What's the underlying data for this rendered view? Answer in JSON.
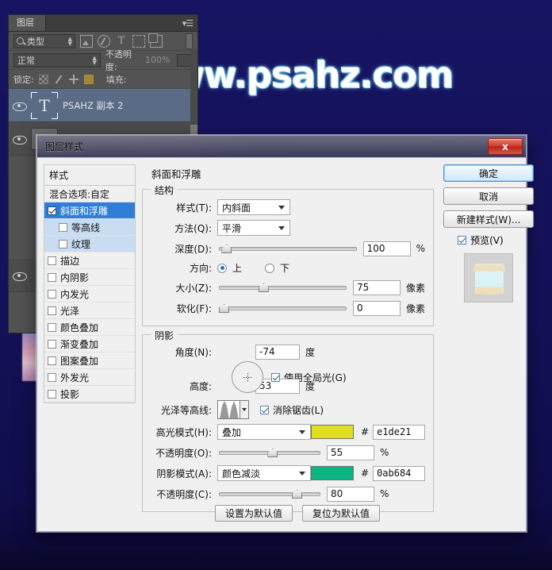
{
  "canvas": {
    "watermark": "www.psahz.com",
    "bg_color": "#14125a"
  },
  "layers_panel": {
    "tab_label": "图层",
    "menu_icon": "panel-menu-icon",
    "filter": {
      "search_icon": "search-icon",
      "type_label": "类型",
      "icons": [
        "image-filter-icon",
        "adjustment-filter-icon",
        "text-filter-icon",
        "shape-filter-icon",
        "smartobject-filter-icon"
      ]
    },
    "blend_mode": "正常",
    "opacity_label": "不透明度:",
    "opacity_value": "100%",
    "lock_label": "锁定:",
    "fill_label": "填充:",
    "lock_icons": [
      "lock-transparent-icon",
      "lock-brush-icon",
      "lock-move-icon",
      "lock-all-icon"
    ],
    "layers": [
      {
        "name": "PSAHZ 副本 2",
        "type": "text",
        "visible": true,
        "selected": true
      },
      {
        "name": "",
        "type": "raster",
        "visible": true,
        "selected": false
      },
      {
        "name": "",
        "type": "raster",
        "visible": true,
        "selected": false
      }
    ]
  },
  "dialog": {
    "title": "图层样式",
    "close_label": "x",
    "styles": {
      "header": "样式",
      "items": [
        {
          "label": "混合选项:自定",
          "checkbox": false,
          "has_checkbox": false,
          "state": "plain"
        },
        {
          "label": "斜面和浮雕",
          "checkbox": true,
          "has_checkbox": true,
          "state": "active"
        },
        {
          "label": "等高线",
          "checkbox": false,
          "has_checkbox": true,
          "state": "sub"
        },
        {
          "label": "纹理",
          "checkbox": false,
          "has_checkbox": true,
          "state": "sub"
        },
        {
          "label": "描边",
          "checkbox": false,
          "has_checkbox": true,
          "state": "plain"
        },
        {
          "label": "内阴影",
          "checkbox": false,
          "has_checkbox": true,
          "state": "plain"
        },
        {
          "label": "内发光",
          "checkbox": false,
          "has_checkbox": true,
          "state": "plain"
        },
        {
          "label": "光泽",
          "checkbox": false,
          "has_checkbox": true,
          "state": "plain"
        },
        {
          "label": "颜色叠加",
          "checkbox": false,
          "has_checkbox": true,
          "state": "plain"
        },
        {
          "label": "渐变叠加",
          "checkbox": false,
          "has_checkbox": true,
          "state": "plain"
        },
        {
          "label": "图案叠加",
          "checkbox": false,
          "has_checkbox": true,
          "state": "plain"
        },
        {
          "label": "外发光",
          "checkbox": false,
          "has_checkbox": true,
          "state": "plain"
        },
        {
          "label": "投影",
          "checkbox": false,
          "has_checkbox": true,
          "state": "plain"
        }
      ]
    },
    "panel_title": "斜面和浮雕",
    "structure": {
      "legend": "结构",
      "style_label": "样式(T):",
      "style_value": "内斜面",
      "technique_label": "方法(Q):",
      "technique_value": "平滑",
      "depth_label": "深度(D):",
      "depth_value": "100",
      "depth_unit": "%",
      "depth_percent": 6,
      "direction_label": "方向:",
      "direction_up": "上",
      "direction_down": "下",
      "direction_selected": "上",
      "size_label": "大小(Z):",
      "size_value": "75",
      "size_unit": "像素",
      "size_percent": 33,
      "soften_label": "软化(F):",
      "soften_value": "0",
      "soften_unit": "像素",
      "soften_percent": 1
    },
    "shading": {
      "legend": "阴影",
      "angle_label": "角度(N):",
      "angle_value": "-74",
      "angle_unit": "度",
      "global_light_label": "使用全局光(G)",
      "global_light_checked": true,
      "altitude_label": "高度:",
      "altitude_value": "53",
      "altitude_unit": "度",
      "gloss_contour_label": "光泽等高线:",
      "antialias_label": "消除锯齿(L)",
      "antialias_checked": true,
      "highlight_mode_label": "高光模式(H):",
      "highlight_mode_value": "叠加",
      "highlight_color": "#e1de21",
      "highlight_hex": "e1de21",
      "highlight_opacity_label": "不透明度(O):",
      "highlight_opacity_value": "55",
      "highlight_opacity_unit": "%",
      "highlight_opacity_percent": 50,
      "shadow_mode_label": "阴影模式(A):",
      "shadow_mode_value": "颜色减淡",
      "shadow_color": "#0ab684",
      "shadow_hex": "0ab684",
      "shadow_opacity_label": "不透明度(C):",
      "shadow_opacity_value": "80",
      "shadow_opacity_unit": "%",
      "shadow_opacity_percent": 74,
      "hash": "#"
    },
    "buttons": {
      "ok": "确定",
      "cancel": "取消",
      "new_style": "新建样式(W)...",
      "preview_label": "预览(V)",
      "preview_checked": true,
      "set_default": "设置为默认值",
      "reset_default": "复位为默认值"
    }
  }
}
